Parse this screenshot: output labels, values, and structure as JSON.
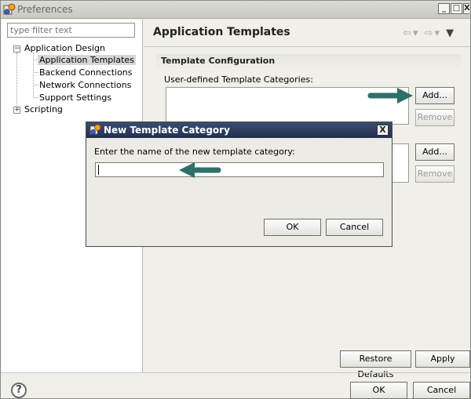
{
  "window": {
    "title": "Preferences",
    "controls": {
      "minimize": "_",
      "maximize": "□",
      "close": "X"
    }
  },
  "sidebar": {
    "filter_placeholder": "type filter text",
    "tree": [
      {
        "label": "Application Design",
        "expanded": true,
        "children": [
          {
            "label": "Application Templates",
            "selected": true
          },
          {
            "label": "Backend Connections"
          },
          {
            "label": "Network Connections"
          },
          {
            "label": "Support Settings"
          }
        ]
      },
      {
        "label": "Scripting",
        "expanded": false
      }
    ]
  },
  "main": {
    "page_title": "Application Templates",
    "section_title": "Template Configuration",
    "categories_label": "User-defined Template Categories:",
    "add_label": "Add...",
    "remove_label": "Remove",
    "restore_defaults_label": "Restore Defaults",
    "apply_label": "Apply"
  },
  "footer": {
    "ok_label": "OK",
    "cancel_label": "Cancel"
  },
  "dialog": {
    "title": "New Template Category",
    "close_label": "X",
    "prompt": "Enter the name of the new template category:",
    "input_value": "",
    "ok_label": "OK",
    "cancel_label": "Cancel"
  },
  "colors": {
    "dialog_title_bg": "#22304f",
    "annotation_arrow": "#2f6f6a"
  }
}
